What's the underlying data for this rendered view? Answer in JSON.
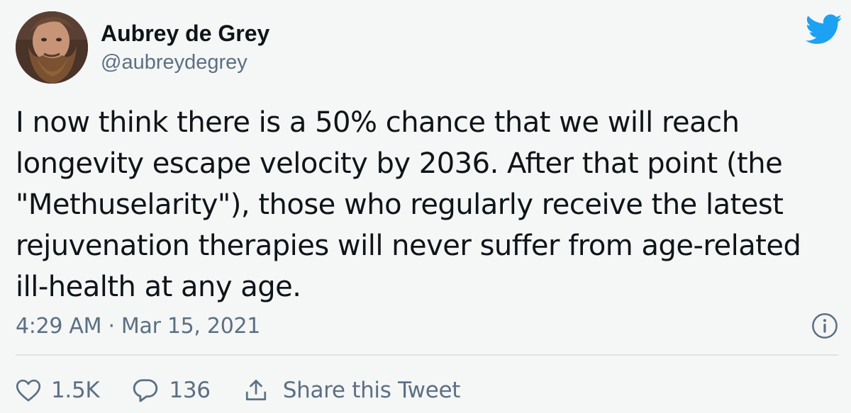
{
  "author": {
    "display_name": "Aubrey de Grey",
    "handle": "@aubreydegrey"
  },
  "tweet": {
    "text": "I now think there is a 50% chance that we will reach\nlongevity escape velocity by 2036. After that point (the\n\"Methuselarity\"), those who regularly receive the latest\nrejuvenation therapies will never suffer from age-related\nill-health at any age.",
    "timestamp": "4:29 AM · Mar 15, 2021"
  },
  "actions": {
    "like_count": "1.5K",
    "reply_count": "136",
    "share_label": "Share this Tweet"
  },
  "icons": {
    "brand": "twitter-bird-icon",
    "info": "info-icon",
    "like": "heart-icon",
    "reply": "reply-bubble-icon",
    "share": "share-upload-icon"
  },
  "colors": {
    "brand_blue": "#1da1f2",
    "secondary_text": "#5b7083",
    "primary_text": "#0f1419",
    "divider": "#dfe3e5",
    "background": "#f5f6f6"
  }
}
